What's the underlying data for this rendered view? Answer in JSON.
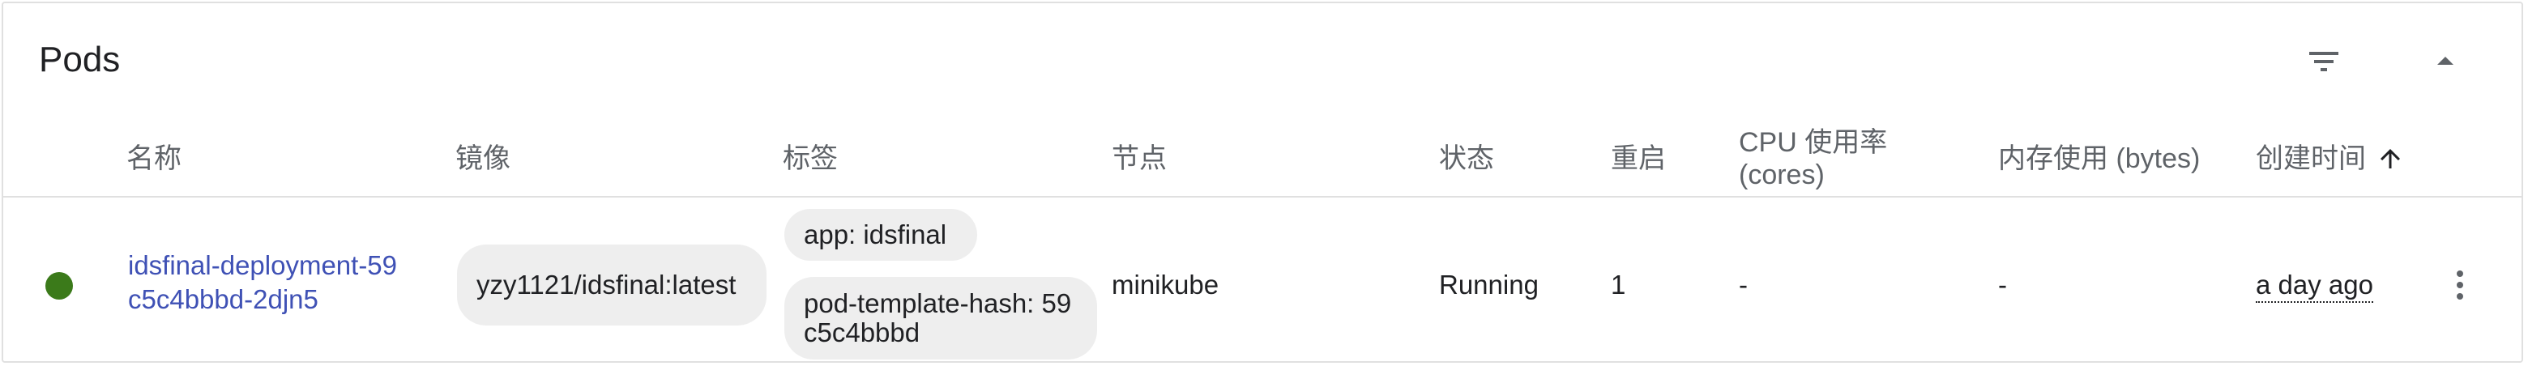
{
  "card": {
    "title": "Pods",
    "filter_icon": "filter-list-icon",
    "collapse_icon": "arrow-drop-up-icon"
  },
  "table": {
    "headers": {
      "name": "名称",
      "image": "镜像",
      "labels": "标签",
      "node": "节点",
      "status": "状态",
      "restarts": "重启",
      "cpu": "CPU 使用率 (cores)",
      "memory": "内存使用 (bytes)",
      "created": "创建时间",
      "sort_icon": "arrow-upward-icon"
    },
    "rows": [
      {
        "status_color": "#3b7a1a",
        "name": "idsfinal-deployment-59c5c4bbbd-2djn5",
        "image": "yzy1121/idsfinal:latest",
        "labels": [
          "app: idsfinal",
          "pod-template-hash: 59c5c4bbbd"
        ],
        "node": "minikube",
        "status": "Running",
        "restarts": "1",
        "cpu": "-",
        "memory": "-",
        "created": "a day ago",
        "actions_icon": "more-vert-icon"
      }
    ]
  }
}
